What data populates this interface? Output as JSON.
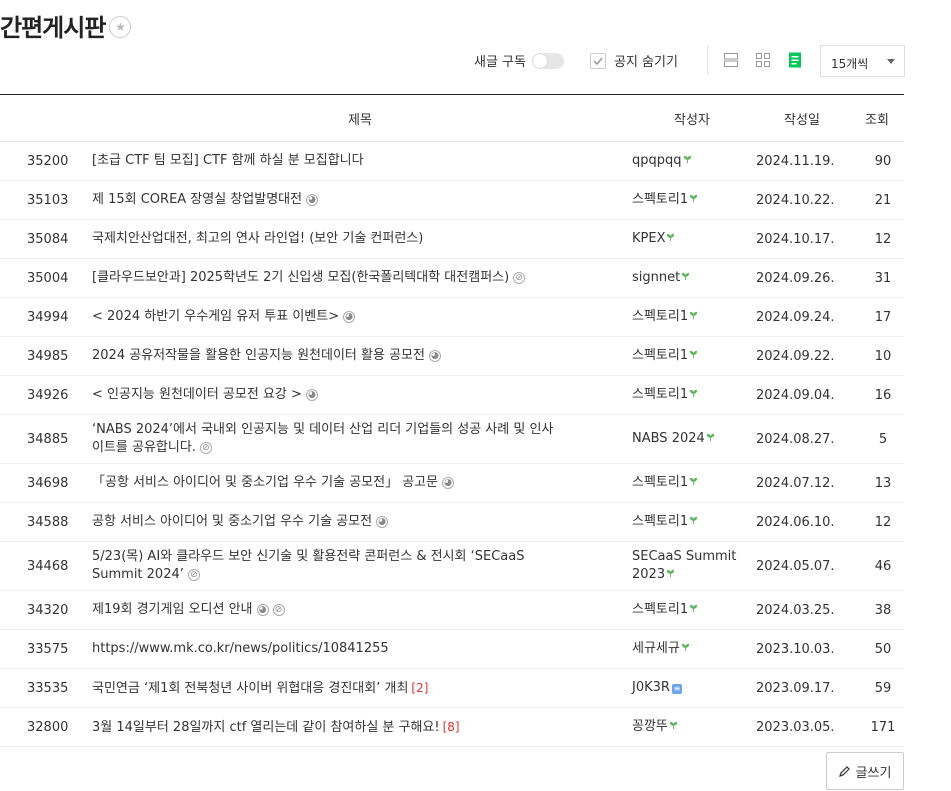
{
  "board": {
    "title": "간편게시판",
    "favorite_icon": "star-icon"
  },
  "toolbar": {
    "subscribe_label": "새글 구독",
    "notice_hide_label": "공지 숨기기",
    "page_size": "15개씩",
    "accent_color": "#03c75a"
  },
  "table": {
    "headers": {
      "title": "제목",
      "author": "작성자",
      "date": "작성일",
      "views": "조회"
    },
    "rows": [
      {
        "num": "35200",
        "title": "[초급 CTF 팀 모집] CTF 함께 하실 분 모집합니다",
        "author": "qpqpqq",
        "date": "2024.11.19.",
        "views": "90"
      },
      {
        "num": "35103",
        "title": "제 15회 COREA 장영실 창업발명대전",
        "author": "스펙토리1",
        "date": "2024.10.22.",
        "views": "21"
      },
      {
        "num": "35084",
        "title": "국제치안산업대전, 최고의 연사 라인업! (보안 기술 컨퍼런스)",
        "author": "KPEX",
        "date": "2024.10.17.",
        "views": "12"
      },
      {
        "num": "35004",
        "title": "[클라우드보안과] 2025학년도 2기 신입생 모집(한국폴리텍대학 대전캠퍼스)",
        "author": "signnet",
        "date": "2024.09.26.",
        "views": "31"
      },
      {
        "num": "34994",
        "title": "< 2024 하반기 우수게임 유저 투표 이벤트>",
        "author": "스펙토리1",
        "date": "2024.09.24.",
        "views": "17"
      },
      {
        "num": "34985",
        "title": "2024 공유저작물을 활용한 인공지능 원천데이터 활용 공모전",
        "author": "스펙토리1",
        "date": "2024.09.22.",
        "views": "10"
      },
      {
        "num": "34926",
        "title": "< 인공지능 원천데이터 공모전 요강 >",
        "author": "스펙토리1",
        "date": "2024.09.04.",
        "views": "16"
      },
      {
        "num": "34885",
        "title_line1": "‘NABS 2024’에서 국내외 인공지능 및 데이터 산업 리더 기업들의 성공 사례 및 인사",
        "title_line2": "이트를 공유합니다.",
        "author": "NABS 2024",
        "date": "2024.08.27.",
        "views": "5"
      },
      {
        "num": "34698",
        "title": "「공항 서비스 아이디어 및 중소기업 우수 기술 공모전」 공고문",
        "author": "스펙토리1",
        "date": "2024.07.12.",
        "views": "13"
      },
      {
        "num": "34588",
        "title": "공항 서비스 아이디어 및 중소기업 우수 기술 공모전",
        "author": "스펙토리1",
        "date": "2024.06.10.",
        "views": "12"
      },
      {
        "num": "34468",
        "title_line1": "5/23(목) AI와 클라우드 보안 신기술 및 활용전략 콘퍼런스 & 전시회 ‘SECaaS",
        "title_line2": "Summit 2024’",
        "author_line1": "SECaaS Summit",
        "author_line2": "2023",
        "date": "2024.05.07.",
        "views": "46"
      },
      {
        "num": "34320",
        "title": "제19회 경기게임 오디션 안내",
        "author": "스펙토리1",
        "date": "2024.03.25.",
        "views": "38"
      },
      {
        "num": "33575",
        "title": "https://www.mk.co.kr/news/politics/10841255",
        "author": "세규세규",
        "date": "2023.10.03.",
        "views": "50"
      },
      {
        "num": "33535",
        "title": "국민연금 ‘제1회 전북청년 사이버 위협대응 경진대회’ 개최",
        "comments": "[2]",
        "author": "J0K3R",
        "date": "2023.09.17.",
        "views": "59"
      },
      {
        "num": "32800",
        "title": "3월 14일부터 28일까지 ctf 열리는데 같이 참여하실 분 구해요!",
        "comments": "[8]",
        "author": "꽁깡뚜",
        "date": "2023.03.05.",
        "views": "171"
      }
    ]
  },
  "write_button": {
    "label": "글쓰기"
  }
}
